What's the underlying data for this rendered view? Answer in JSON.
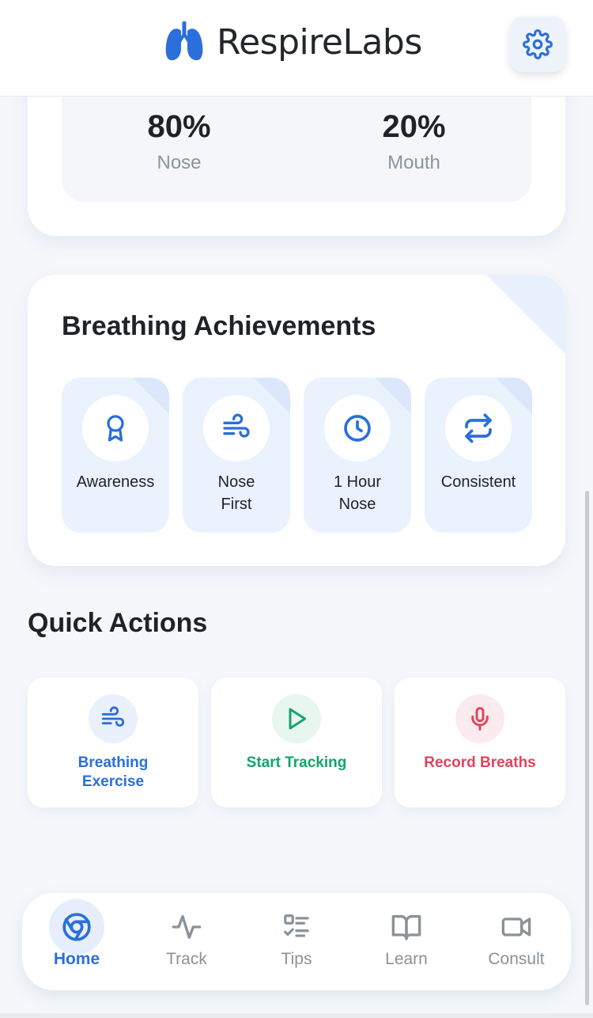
{
  "header": {
    "app_name": "RespireLabs",
    "logo_icon": "lungs-icon",
    "settings_icon": "gear-icon",
    "brand_color": "#2a6fdb"
  },
  "breathing_ratio": {
    "nose_value": "80%",
    "nose_label": "Nose",
    "mouth_value": "20%",
    "mouth_label": "Mouth"
  },
  "achievements": {
    "title": "Breathing Achievements",
    "badges": [
      {
        "label": "Awareness",
        "icon": "award-ribbon-icon"
      },
      {
        "label": "Nose\nFirst",
        "icon": "wind-icon"
      },
      {
        "label": "1 Hour\nNose",
        "icon": "clock-icon"
      },
      {
        "label": "Consistent",
        "icon": "repeat-icon"
      }
    ]
  },
  "quick_actions": {
    "title": "Quick Actions",
    "items": [
      {
        "label": "Breathing\nExercise",
        "icon": "wind-icon",
        "color": "#2a6fdb"
      },
      {
        "label": "Start Tracking",
        "icon": "play-icon",
        "color": "#14a36b"
      },
      {
        "label": "Record Breaths",
        "icon": "microphone-icon",
        "color": "#e0435c"
      }
    ]
  },
  "bottom_nav": {
    "active": "Home",
    "items": [
      {
        "label": "Home",
        "icon": "home-circle-icon"
      },
      {
        "label": "Track",
        "icon": "activity-pulse-icon"
      },
      {
        "label": "Tips",
        "icon": "checklist-icon"
      },
      {
        "label": "Learn",
        "icon": "open-book-icon"
      },
      {
        "label": "Consult",
        "icon": "video-camera-icon"
      }
    ]
  }
}
